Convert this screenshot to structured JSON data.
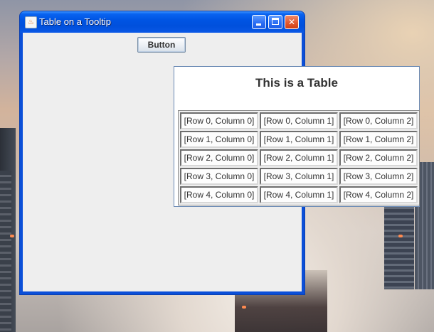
{
  "window": {
    "title": "Table on a Tooltip",
    "controls": {
      "minimize": "minimize",
      "maximize": "maximize",
      "close": "close"
    }
  },
  "content": {
    "button_label": "Button"
  },
  "tooltip": {
    "title": "This is a Table",
    "rows": [
      [
        "[Row 0, Column 0]",
        "[Row 0, Column 1]",
        "[Row 0, Column 2]"
      ],
      [
        "[Row 1, Column 0]",
        "[Row 1, Column 1]",
        "[Row 1, Column 2]"
      ],
      [
        "[Row 2, Column 0]",
        "[Row 2, Column 1]",
        "[Row 2, Column 2]"
      ],
      [
        "[Row 3, Column 0]",
        "[Row 3, Column 1]",
        "[Row 3, Column 2]"
      ],
      [
        "[Row 4, Column 0]",
        "[Row 4, Column 1]",
        "[Row 4, Column 2]"
      ]
    ]
  },
  "colors": {
    "titlebar": "#0054e3",
    "window_frame": "#0b4fd8",
    "client_bg": "#eeeeee",
    "close_button": "#e25a31"
  },
  "icons": [
    "java-cup-icon",
    "minimize-icon",
    "maximize-icon",
    "close-icon"
  ]
}
